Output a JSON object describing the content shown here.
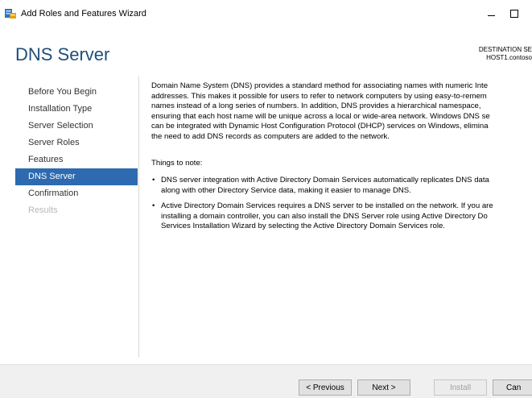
{
  "window": {
    "title": "Add Roles and Features Wizard",
    "minimize_symbol": "–",
    "maximize_symbol": "☐"
  },
  "header": {
    "page_title": "DNS Server",
    "destination_label": "DESTINATION SE",
    "destination_server": "HOST1.contoso"
  },
  "nav": {
    "items": [
      {
        "label": "Before You Begin",
        "state": "normal"
      },
      {
        "label": "Installation Type",
        "state": "normal"
      },
      {
        "label": "Server Selection",
        "state": "normal"
      },
      {
        "label": "Server Roles",
        "state": "normal"
      },
      {
        "label": "Features",
        "state": "normal"
      },
      {
        "label": "DNS Server",
        "state": "active"
      },
      {
        "label": "Confirmation",
        "state": "normal"
      },
      {
        "label": "Results",
        "state": "disabled"
      }
    ]
  },
  "content": {
    "intro_lines": [
      "Domain Name System (DNS) provides a standard method for associating names with numeric Inte",
      "addresses. This makes it possible for users to refer to network computers by using easy-to-remem",
      "names instead of a long series of numbers. In addition, DNS provides a hierarchical namespace,",
      "ensuring that each host name will be unique across a local or wide-area network. Windows DNS se",
      "can be integrated with Dynamic Host Configuration Protocol (DHCP) services on Windows, elimina",
      "the need to add DNS records as computers are added to the network."
    ],
    "notes_heading": "Things to note:",
    "bullet_symbol": "•",
    "bullets": [
      [
        "DNS server integration with Active Directory Domain Services automatically replicates DNS data",
        "along with other Directory Service data, making it easier to manage DNS."
      ],
      [
        "Active Directory Domain Services requires a DNS server to be installed on the network. If you are",
        "installing a domain controller, you can also install the DNS Server role using Active Directory Do",
        "Services Installation Wizard by selecting the Active Directory Domain Services role."
      ]
    ]
  },
  "footer": {
    "previous_label": "< Previous",
    "next_label": "Next >",
    "install_label": "Install",
    "cancel_label": "Can"
  },
  "colors": {
    "accent": "#2d6ab0",
    "title": "#1e4e7a",
    "disabled_text": "#b8b8b8"
  }
}
